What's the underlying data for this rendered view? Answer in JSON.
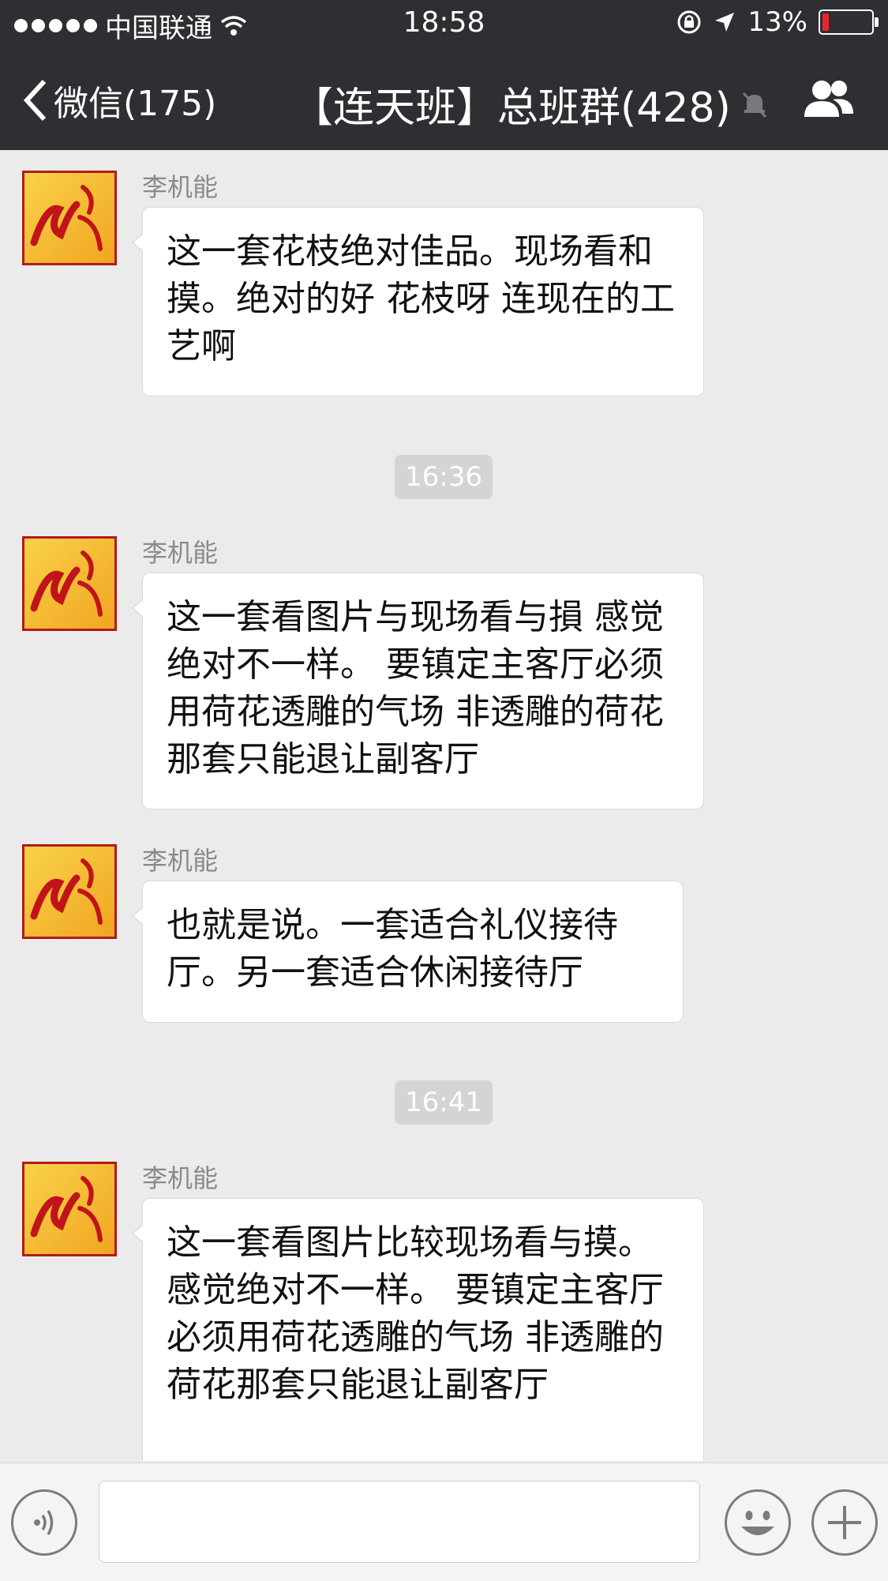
{
  "status_bar": {
    "carrier": "中国联通",
    "time": "18:58",
    "battery": "13%",
    "battery_level": 0.13
  },
  "nav": {
    "back_label": "微信(175)",
    "title": "【连天班】总班群(428)"
  },
  "messages": [
    {
      "sender": "李机能",
      "text": "这一套花枝绝对佳品。现场看和摸。绝对的好 花枝呀 连现在的工艺啊"
    },
    {
      "sender": "李机能",
      "text": "这一套看图片与现场看与損 感觉绝对不一样。 要镇定主客厅必须用荷花透雕的气场 非透雕的荷花那套只能退让副客厅"
    },
    {
      "sender": "李机能",
      "text": "也就是说。一套适合礼仪接待厅。另一套适合休闲接待厅"
    },
    {
      "sender": "李机能",
      "text": "这一套看图片比较现场看与摸。感觉绝对不一样。 要镇定主客厅必须用荷花透雕的气场 非透雕的荷花那套只能退让副客厅"
    }
  ],
  "timestamps": [
    "16:36",
    "16:41"
  ],
  "colors": {
    "nav_bg": "#2e2e33",
    "chat_bg": "#ebebeb",
    "battery_low": "#e8262a",
    "avatar_red": "#b11b1b"
  },
  "icons": [
    "wifi-icon",
    "lock-rotation-icon",
    "location-arrow-icon",
    "battery-icon",
    "back-chevron-icon",
    "mute-bell-icon",
    "group-members-icon",
    "voice-icon",
    "emoji-icon",
    "plus-icon"
  ]
}
